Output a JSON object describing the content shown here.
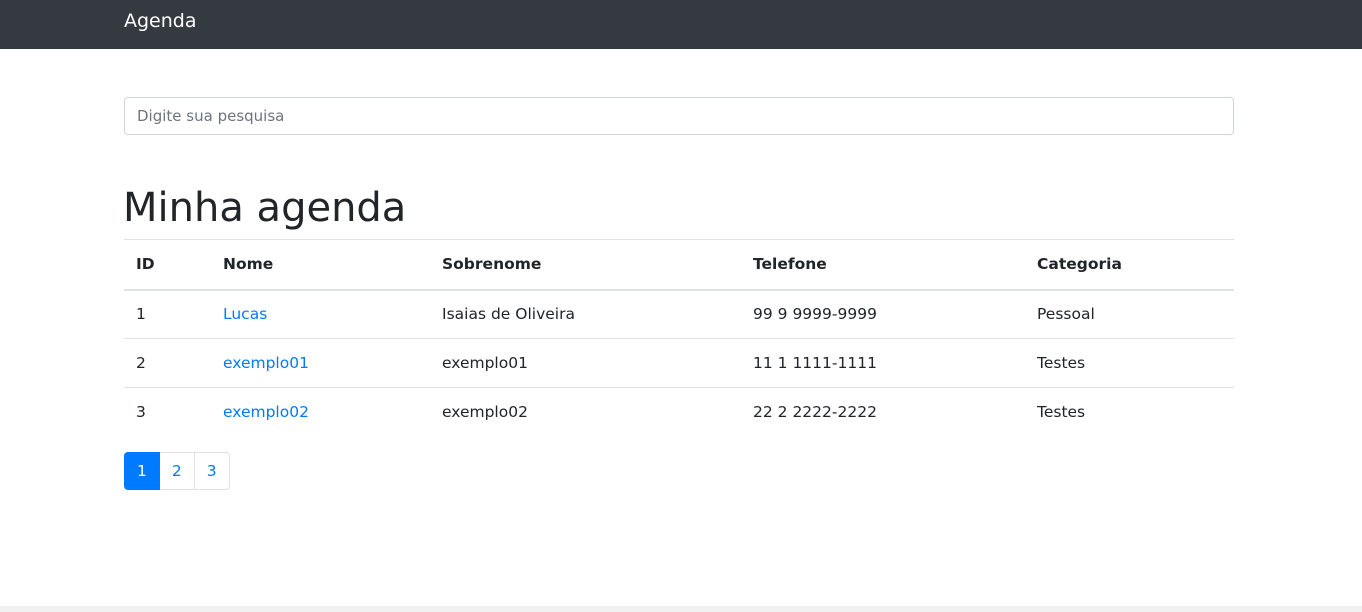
{
  "navbar": {
    "brand": "Agenda"
  },
  "search": {
    "placeholder": "Digite sua pesquisa"
  },
  "main": {
    "title": "Minha agenda"
  },
  "table": {
    "headers": [
      "ID",
      "Nome",
      "Sobrenome",
      "Telefone",
      "Categoria"
    ],
    "rows": [
      {
        "id": "1",
        "nome": "Lucas",
        "sobrenome": "Isaias de Oliveira",
        "telefone": "99 9 9999-9999",
        "categoria": "Pessoal"
      },
      {
        "id": "2",
        "nome": "exemplo01",
        "sobrenome": "exemplo01",
        "telefone": "11 1 1111-1111",
        "categoria": "Testes"
      },
      {
        "id": "3",
        "nome": "exemplo02",
        "sobrenome": "exemplo02",
        "telefone": "22 2 2222-2222",
        "categoria": "Testes"
      }
    ]
  },
  "pagination": {
    "pages": [
      "1",
      "2",
      "3"
    ],
    "active": "1"
  },
  "colors": {
    "navbar": "#343a40",
    "link": "#007bff",
    "active_page": "#007bff"
  }
}
